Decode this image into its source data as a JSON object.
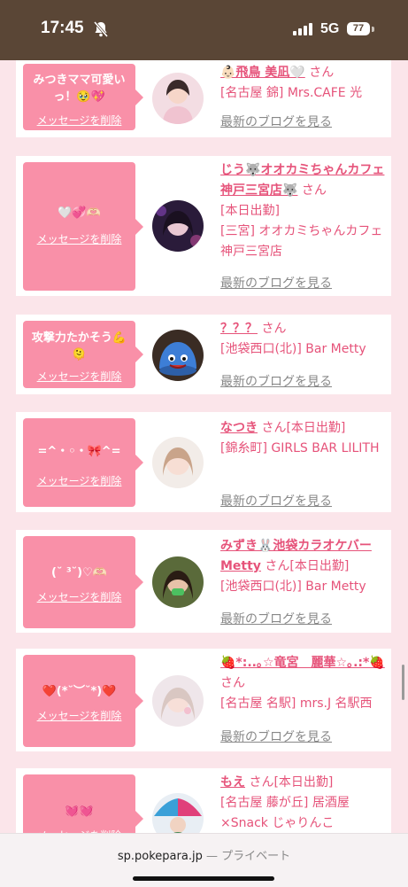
{
  "status": {
    "time": "17:45",
    "network": "5G",
    "battery": "77"
  },
  "browser": {
    "url": "sp.pokepara.jp",
    "separator": " — ",
    "private": "プライベート"
  },
  "delete_label": "メッセージを削除",
  "blog_label": "最新のブログを見る",
  "san": "さん",
  "cards": [
    {
      "msg": "みつきママ可愛い っ！🥹💖",
      "name": "👶🏻飛鳥 美凪🤍",
      "badge": "",
      "lines": [
        "[名古屋 錦] Mrs.CAFE 光"
      ]
    },
    {
      "msg": "🤍💞🫶🏻",
      "name": "じう🐺オオカミちゃんカフェ神戸三宮店🐺",
      "badge": "",
      "lines": [
        "[本日出勤]",
        "[三宮] オオカミちゃんカフェ神戸三宮店"
      ]
    },
    {
      "msg": "攻撃力たかそう💪 🫠",
      "name": "？？？",
      "badge": "",
      "lines": [
        "[池袋西口(北)] Bar Metty"
      ]
    },
    {
      "msg": "=^・◦・🎀^=",
      "name": "なつき",
      "badge": "[本日出勤]",
      "lines": [
        "[錦糸町] GIRLS BAR LILITH"
      ]
    },
    {
      "msg": "(˘ ³˘)♡🫶🏻",
      "name": "みずき🐰池袋カラオケバーMetty",
      "badge": "[本日出勤]",
      "lines": [
        "[池袋西口(北)] Bar Metty"
      ]
    },
    {
      "msg": "❤️(*˘︶˘*)❤️",
      "name": "🍓*:..｡☆竜宮　麗華☆｡.:*🍓",
      "badge": "",
      "lines": [
        "[名古屋 名駅] mrs.J 名駅西"
      ]
    },
    {
      "msg": "💓💓",
      "name": "もえ",
      "badge": "[本日出勤]",
      "lines": [
        "[名古屋 藤が丘] 居酒屋 ×Snack じゃりんこ"
      ]
    }
  ]
}
